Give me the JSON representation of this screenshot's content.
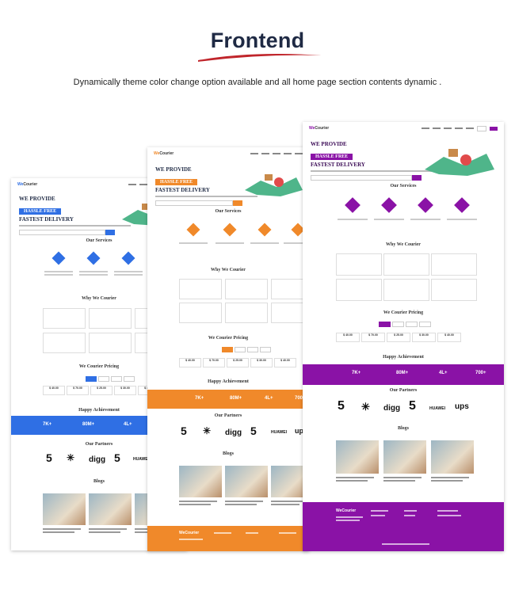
{
  "header": {
    "logo_text": "Frontend",
    "tagline": "Dynamically theme color change option available and all home page section contents dynamic ."
  },
  "colors": {
    "blue": "#2f6fe4",
    "orange": "#f0892a",
    "purple": "#8a12a6",
    "dark_navy": "#1f2a44",
    "swoosh_red": "#c0252b"
  },
  "screens": [
    {
      "theme": "blue",
      "brand_prefix": "We",
      "brand_suffix": "Courier",
      "hero": {
        "line1": "WE PROVIDE",
        "pill": "HASSLE FREE",
        "line2": "FASTEST DELIVERY"
      },
      "sections": {
        "services": "Our Services",
        "why": "Why We Courier",
        "pricing": "We Courier Pricing",
        "achievement": "Happy Achievement",
        "partners": "Our Partners",
        "blogs": "Blogs"
      },
      "stats": [
        "7K+",
        "80M+",
        "4L+"
      ]
    },
    {
      "theme": "orange",
      "brand_prefix": "We",
      "brand_suffix": "Courier",
      "hero": {
        "line1": "WE PROVIDE",
        "pill": "HASSLE FREE",
        "line2": "FASTEST DELIVERY"
      },
      "sections": {
        "services": "Our Services",
        "why": "Why We Courier",
        "pricing": "We Courier Pricing",
        "achievement": "Happy Achievement",
        "partners": "Our Partners",
        "blogs": "Blogs"
      },
      "stats": [
        "7K+",
        "80M+",
        "4L+",
        "700"
      ],
      "footer_brand": "WeCourier"
    },
    {
      "theme": "purple",
      "brand_prefix": "We",
      "brand_suffix": "Courier",
      "hero": {
        "line1": "WE PROVIDE",
        "pill": "HASSLE FREE",
        "line2": "FASTEST DELIVERY"
      },
      "sections": {
        "services": "Our Services",
        "why": "Why We Courier",
        "pricing": "We Courier Pricing",
        "achievement": "Happy Achievement",
        "partners": "Our Partners",
        "blogs": "Blogs"
      },
      "stats": [
        "7K+",
        "80M+",
        "4L+",
        "700+"
      ],
      "footer_brand": "WeCourier"
    }
  ],
  "partners": [
    "5",
    "✳",
    "digg",
    "5",
    "HUAWEI",
    "ups"
  ],
  "prices": [
    "$ 40.00",
    "$ 70.00",
    "$ 25.00",
    "$ 30.00",
    "$ 40.00"
  ]
}
